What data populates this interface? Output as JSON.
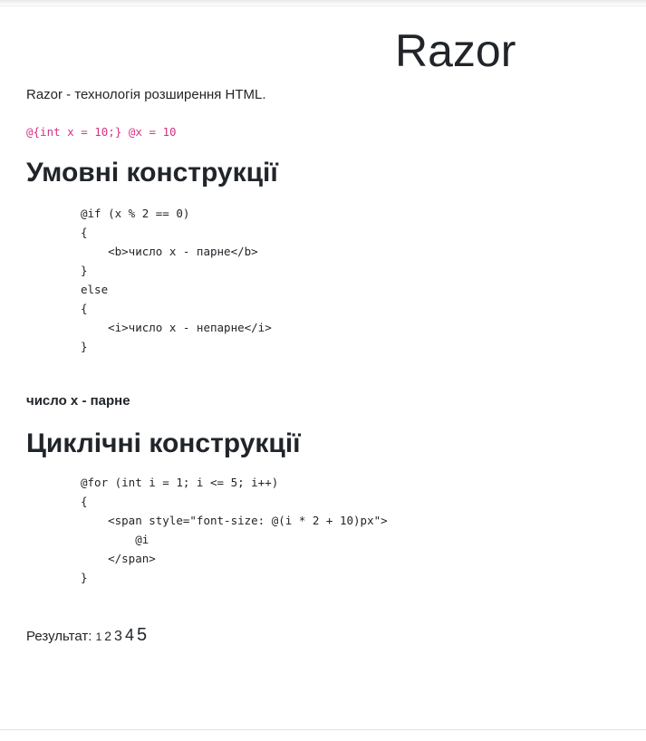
{
  "page": {
    "title": "Razor",
    "intro": "Razor - технологія розширення HTML.",
    "inline_code": "@{int x = 10;} @x = 10"
  },
  "conditional": {
    "heading": "Умовні конструкції",
    "code_lines": [
      "@if (x % 2 == 0)",
      "{",
      "    <b>число x - парне</b>",
      "}",
      "else",
      "{",
      "    <i>число x - непарне</i>",
      "}"
    ],
    "result": "число x - парне"
  },
  "loop": {
    "heading": "Циклічні конструкції",
    "code_lines": [
      "@for (int i = 1; i <= 5; i++)",
      "{",
      "    <span style=\"font-size: @(i * 2 + 10)px\">",
      "        @i",
      "    </span>",
      "}"
    ],
    "result_label": "Результат:",
    "result_numbers": [
      "1",
      "2",
      "3",
      "4",
      "5"
    ]
  }
}
